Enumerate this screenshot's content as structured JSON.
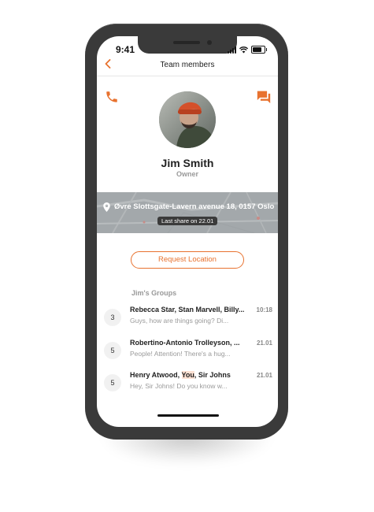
{
  "status_bar": {
    "time": "9:41"
  },
  "nav": {
    "title": "Team members"
  },
  "profile": {
    "name": "Jim Smith",
    "role": "Owner"
  },
  "location": {
    "address": "Øvre Slottsgate-Lavern avenue 18, 0157 Oslo",
    "last_share": "Last share on 22.01"
  },
  "actions": {
    "request_location": "Request Location"
  },
  "groups": {
    "title": "Jim's Groups",
    "items": [
      {
        "count": "3",
        "title": "Rebecca Star, Stan Marvell, Billy...",
        "time": "10:18",
        "message": "Guys, how are things going? Di..."
      },
      {
        "count": "5",
        "title": "Robertino-Antonio Trolleyson, ...",
        "time": "21.01",
        "message": "People! Attention! There's a hug..."
      },
      {
        "count": "5",
        "title_before": "Henry Atwood, ",
        "title_highlight": "You",
        "title_after": ", Sir Johns",
        "time": "21.01",
        "message": "Hey, Sir Johns! Do you know w..."
      }
    ]
  },
  "colors": {
    "accent": "#e8722f",
    "phone_frame": "#3a3a3a",
    "map_overlay": "#a3a8ab"
  },
  "icons": [
    "chevron-left-icon",
    "phone-icon",
    "chat-icon",
    "location-pin-icon",
    "signal-icon",
    "wifi-icon",
    "battery-icon"
  ]
}
